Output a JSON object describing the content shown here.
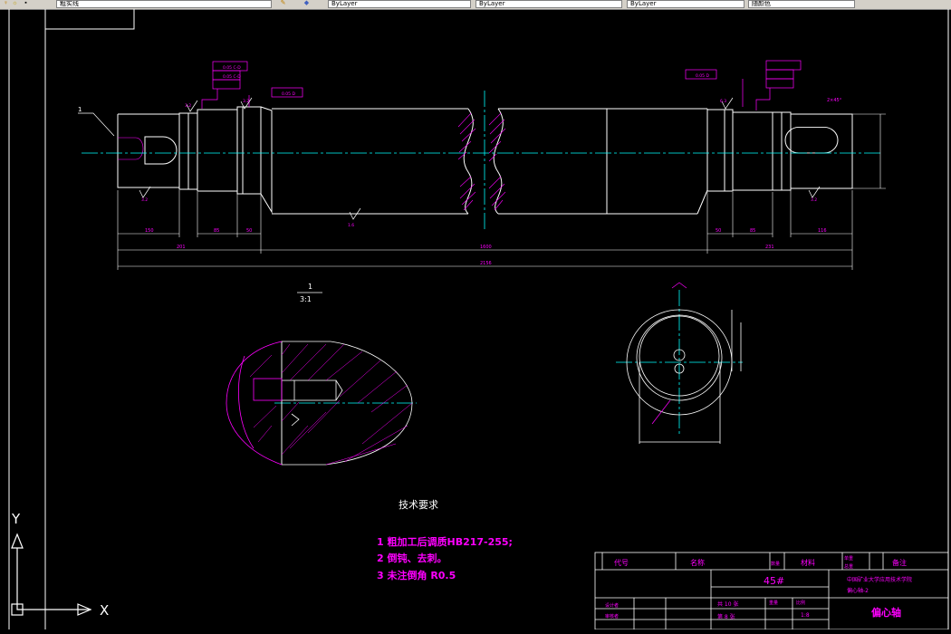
{
  "toolbar": {
    "layer_name": "粗实线",
    "linetype_1": "ByLayer",
    "linetype_2": "ByLayer",
    "lineweight": "ByLayer",
    "plot_style": "随颜色"
  },
  "drawing": {
    "detail_label": "1",
    "detail_scale": "3:1",
    "tech_title": "技术要求",
    "requirements": [
      "1 粗加工后调质HB217-255;",
      "2 倒钝、去刺。",
      "3 未注倒角 R0.5"
    ],
    "chamfer_note": "2×45°",
    "dims": {
      "d1": "150",
      "d2": "201",
      "d3": "85",
      "d4": "1600",
      "d5": "2156",
      "d6": "231",
      "d7": "116",
      "d8": "50",
      "d9": "85",
      "d10": "50"
    },
    "tol_frames": [
      "0.05 C-D",
      "0.05 C-D",
      "0.05 D",
      "0.05 D"
    ],
    "surface_marks": [
      "3.2",
      "3.2",
      "1.6",
      "3.2",
      "3.2",
      "6.3"
    ]
  },
  "title_block": {
    "col_code": "代号",
    "col_name": "名称",
    "col_qty": "数量",
    "col_material": "材料",
    "col_unit_weight": "单重",
    "col_total_weight": "总重",
    "col_remarks": "备注",
    "material": "45#",
    "school": "中国矿业大学应用技术学院",
    "drawing_no": "偏心轴-2",
    "sheet_total": "共 10 张",
    "sheet_no": "第 8 张",
    "weight_label": "重量",
    "scale_label": "比例",
    "scale": "1:8",
    "part_name": "偏心轴",
    "designer": "设计者",
    "checker": "审核者"
  },
  "ucs": {
    "x_label": "X",
    "y_label": "Y"
  },
  "colors": {
    "background": "#000000",
    "outline": "#ffffff",
    "dimension": "#ff00ff",
    "centerline": "#00ffff",
    "magenta_text": "#ff00ff"
  }
}
